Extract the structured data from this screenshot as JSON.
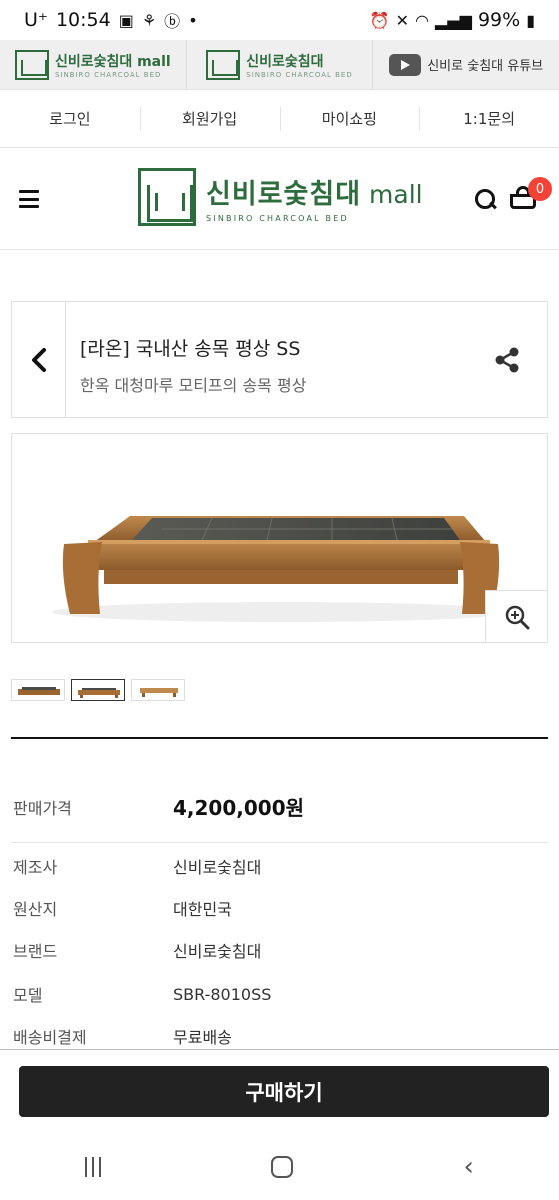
{
  "status_bar": {
    "carrier": "U⁺",
    "time": "10:54",
    "battery": "99%"
  },
  "banner": {
    "item1_text": "신비로숯침대 mall",
    "item1_sub": "SINBIRO CHARCOAL BED",
    "item2_text": "신비로숯침대",
    "item2_sub": "SINBIRO CHARCOAL BED",
    "item3_text": "신비로 숯침대 유튜브"
  },
  "member_nav": {
    "login": "로그인",
    "join": "회원가입",
    "myshop": "마이쇼핑",
    "inquiry": "1:1문의"
  },
  "header": {
    "logo_title": "신비로숯침대",
    "logo_mall": "mall",
    "logo_sub": "SINBIRO CHARCOAL BED",
    "cart_count": "0"
  },
  "product": {
    "name": "[라온] 국내산 송목 평상 SS",
    "description": "한옥 대청마루 모티프의 송목 평상"
  },
  "info": {
    "price_label": "판매가격",
    "price_value": "4,200,000원",
    "maker_label": "제조사",
    "maker_value": "신비로숯침대",
    "origin_label": "원산지",
    "origin_value": "대한민국",
    "brand_label": "브랜드",
    "brand_value": "신비로숯침대",
    "model_label": "모델",
    "model_value": "SBR-8010SS",
    "shipping_label": "배송비결제",
    "shipping_value": "무료배송"
  },
  "buy": {
    "label": "구매하기"
  },
  "colors": {
    "brand_green": "#2e6b3d",
    "badge_red": "#f44336",
    "buy_button": "#222222"
  }
}
